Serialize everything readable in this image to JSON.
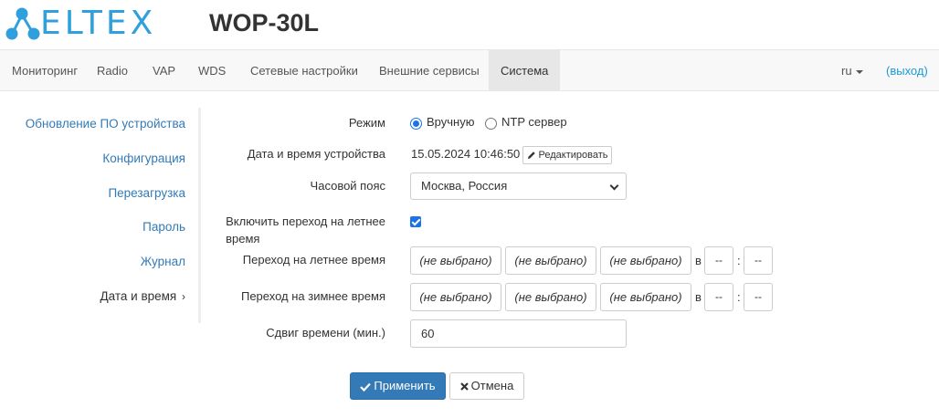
{
  "header": {
    "logo_text": "ELTEX",
    "model": "WOP-30L"
  },
  "navbar": {
    "items": [
      {
        "label": "Мониторинг",
        "active": false
      },
      {
        "label": "Radio",
        "active": false
      },
      {
        "label": "VAP",
        "active": false
      },
      {
        "label": "WDS",
        "active": false
      },
      {
        "label": "Сетевые настройки",
        "active": false
      },
      {
        "label": "Внешние сервисы",
        "active": false
      },
      {
        "label": "Система",
        "active": true
      }
    ],
    "language": "ru",
    "logout": "(выход)"
  },
  "sidebar": {
    "items": [
      {
        "label": "Обновление ПО устройства",
        "active": false
      },
      {
        "label": "Конфигурация",
        "active": false
      },
      {
        "label": "Перезагрузка",
        "active": false
      },
      {
        "label": "Пароль",
        "active": false
      },
      {
        "label": "Журнал",
        "active": false
      },
      {
        "label": "Дата и время",
        "active": true,
        "chevron": "›"
      }
    ]
  },
  "form": {
    "mode": {
      "label": "Режим",
      "options": [
        {
          "label": "Вручную",
          "checked": true
        },
        {
          "label": "NTP сервер",
          "checked": false
        }
      ]
    },
    "device_datetime": {
      "label": "Дата и время устройства",
      "value": "15.05.2024 10:46:50",
      "edit_button": "Редактировать"
    },
    "timezone": {
      "label": "Часовой пояс",
      "value": "Москва, Россия"
    },
    "dst_enable": {
      "label_line1": "Включить переход на летнее",
      "label_line2": "время",
      "checked": true
    },
    "dst_start": {
      "label": "Переход на летнее время",
      "selects": [
        "(не выбрано)",
        "(не выбрано)",
        "(не выбрано)"
      ],
      "at": "в",
      "hour": "--",
      "colon": ":",
      "minute": "--"
    },
    "dst_end": {
      "label": "Переход на зимнее время",
      "selects": [
        "(не выбрано)",
        "(не выбрано)",
        "(не выбрано)"
      ],
      "at": "в",
      "hour": "--",
      "colon": ":",
      "minute": "--"
    },
    "time_shift": {
      "label": "Сдвиг времени (мин.)",
      "value": "60"
    }
  },
  "actions": {
    "apply": "Применить",
    "cancel": "Отмена"
  },
  "colors": {
    "brand": "#2fa0dd",
    "link": "#337ab7",
    "primary_button": "#337ab7"
  }
}
